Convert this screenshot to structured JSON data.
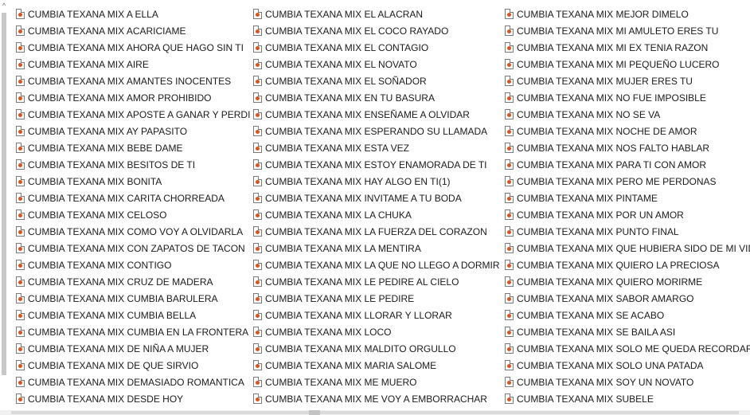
{
  "files": [
    "CUMBIA TEXANA MIX A ELLA",
    "CUMBIA TEXANA MIX ACARICIAME",
    "CUMBIA TEXANA MIX AHORA QUE HAGO SIN TI",
    "CUMBIA TEXANA MIX AIRE",
    "CUMBIA TEXANA MIX AMANTES INOCENTES",
    "CUMBIA TEXANA MIX AMOR PROHIBIDO",
    "CUMBIA TEXANA MIX APOSTE A GANAR Y PERDI",
    "CUMBIA TEXANA MIX AY PAPASITO",
    "CUMBIA TEXANA MIX BEBE DAME",
    "CUMBIA TEXANA MIX BESITOS DE TI",
    "CUMBIA TEXANA MIX BONITA",
    "CUMBIA TEXANA MIX CARITA CHORREADA",
    "CUMBIA TEXANA MIX CELOSO",
    "CUMBIA TEXANA MIX COMO VOY A OLVIDARLA",
    "CUMBIA TEXANA MIX CON ZAPATOS DE TACON",
    "CUMBIA TEXANA MIX CONTIGO",
    "CUMBIA TEXANA MIX CRUZ DE MADERA",
    "CUMBIA TEXANA MIX CUMBIA BARULERA",
    "CUMBIA TEXANA MIX CUMBIA BELLA",
    "CUMBIA TEXANA MIX CUMBIA EN LA FRONTERA",
    "CUMBIA TEXANA MIX DE NIÑA A MUJER",
    "CUMBIA TEXANA MIX DE QUE SIRVIO",
    "CUMBIA TEXANA MIX DEMASIADO ROMANTICA",
    "CUMBIA TEXANA MIX DESDE HOY",
    "CUMBIA TEXANA MIX EL ALACRAN",
    "CUMBIA TEXANA MIX EL COCO RAYADO",
    "CUMBIA TEXANA MIX EL CONTAGIO",
    "CUMBIA TEXANA MIX EL NOVATO",
    "CUMBIA TEXANA MIX EL SOÑADOR",
    "CUMBIA TEXANA MIX EN TU BASURA",
    "CUMBIA TEXANA MIX ENSEÑAME A OLVIDAR",
    "CUMBIA TEXANA MIX ESPERANDO SU LLAMADA",
    "CUMBIA TEXANA MIX ESTA VEZ",
    "CUMBIA TEXANA MIX ESTOY ENAMORADA DE TI",
    "CUMBIA TEXANA MIX HAY ALGO EN TI(1)",
    "CUMBIA TEXANA MIX INVITAME A TU BODA",
    "CUMBIA TEXANA MIX LA CHUKA",
    "CUMBIA TEXANA MIX LA FUERZA DEL CORAZON",
    "CUMBIA TEXANA MIX LA MENTIRA",
    "CUMBIA TEXANA MIX LA QUE NO LLEGO A DORMIR",
    "CUMBIA TEXANA MIX LE PEDIRE AL CIELO",
    "CUMBIA TEXANA MIX LE PEDIRE",
    "CUMBIA TEXANA MIX LLORAR Y LLORAR",
    "CUMBIA TEXANA MIX LOCO",
    "CUMBIA TEXANA MIX MALDITO ORGULLO",
    "CUMBIA TEXANA MIX MARIA SALOME",
    "CUMBIA TEXANA MIX ME MUERO",
    "CUMBIA TEXANA MIX ME VOY A EMBORRACHAR",
    "CUMBIA TEXANA MIX MEJOR DIMELO",
    "CUMBIA TEXANA MIX MI AMULETO ERES TU",
    "CUMBIA TEXANA MIX MI EX TENIA RAZON",
    "CUMBIA TEXANA MIX MI PEQUEÑO LUCERO",
    "CUMBIA TEXANA MIX MUJER ERES TU",
    "CUMBIA TEXANA MIX NO FUE IMPOSIBLE",
    "CUMBIA TEXANA MIX NO SE VA",
    "CUMBIA TEXANA MIX NOCHE DE AMOR",
    "CUMBIA TEXANA MIX NOS FALTO HABLAR",
    "CUMBIA TEXANA MIX PARA TI CON AMOR",
    "CUMBIA TEXANA MIX PERO ME PERDONAS",
    "CUMBIA TEXANA MIX PINTAME",
    "CUMBIA TEXANA MIX POR UN AMOR",
    "CUMBIA TEXANA MIX PUNTO FINAL",
    "CUMBIA TEXANA MIX QUE HUBIERA SIDO DE MI VIDA",
    "CUMBIA TEXANA MIX QUIERO LA PRECIOSA",
    "CUMBIA TEXANA MIX QUIERO MORIRME",
    "CUMBIA TEXANA MIX SABOR AMARGO",
    "CUMBIA TEXANA MIX SE ACABO",
    "CUMBIA TEXANA MIX SE BAILA ASI",
    "CUMBIA TEXANA MIX SOLO ME QUEDA RECORDAR",
    "CUMBIA TEXANA MIX SOLO UNA PATADA",
    "CUMBIA TEXANA MIX SOY UN NOVATO",
    "CUMBIA TEXANA MIX SUBELE"
  ],
  "file_icon": "audio-file-icon",
  "scroll_up_icon": "chevron-up-icon"
}
